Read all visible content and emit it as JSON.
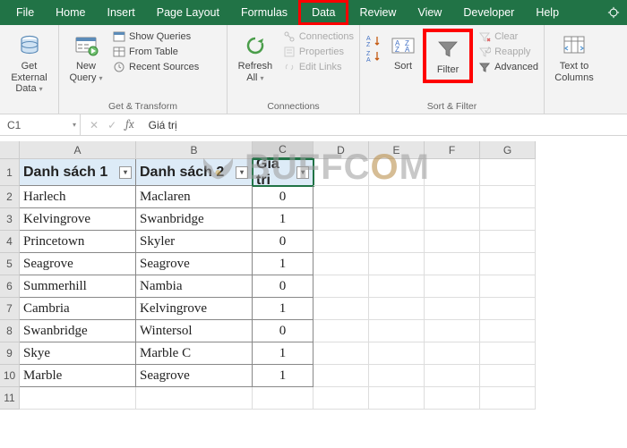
{
  "tabs": {
    "file": "File",
    "home": "Home",
    "insert": "Insert",
    "pageLayout": "Page Layout",
    "formulas": "Formulas",
    "data": "Data",
    "review": "Review",
    "view": "View",
    "developer": "Developer",
    "help": "Help"
  },
  "ribbon": {
    "getExternal": {
      "label": "Get External\nData"
    },
    "newQuery": {
      "label": "New\nQuery"
    },
    "getTransform": {
      "label": "Get & Transform",
      "showQueries": "Show Queries",
      "fromTable": "From Table",
      "recentSources": "Recent Sources"
    },
    "refreshAll": {
      "label": "Refresh\nAll"
    },
    "connections": {
      "label": "Connections",
      "connections": "Connections",
      "properties": "Properties",
      "editLinks": "Edit Links"
    },
    "sort": {
      "label": "Sort"
    },
    "filter": {
      "label": "Filter"
    },
    "sortFilter": {
      "label": "Sort & Filter",
      "clear": "Clear",
      "reapply": "Reapply",
      "advanced": "Advanced"
    },
    "textToColumns": {
      "label": "Text to\nColumns"
    }
  },
  "namebox": {
    "value": "C1"
  },
  "formula": {
    "value": "Giá trị"
  },
  "columns": {
    "A": "A",
    "B": "B",
    "C": "C",
    "D": "D",
    "E": "E",
    "F": "F",
    "G": "G"
  },
  "table": {
    "headers": {
      "a": "Danh sách 1",
      "b": "Danh sách 2",
      "c": "Giá trị"
    },
    "rows": [
      {
        "n": "2",
        "a": "Harlech",
        "b": "Maclaren",
        "c": "0"
      },
      {
        "n": "3",
        "a": "Kelvingrove",
        "b": "Swanbridge",
        "c": "1"
      },
      {
        "n": "4",
        "a": "Princetown",
        "b": "Skyler",
        "c": "0"
      },
      {
        "n": "5",
        "a": "Seagrove",
        "b": "Seagrove",
        "c": "1"
      },
      {
        "n": "6",
        "a": "Summerhill",
        "b": "Nambia",
        "c": "0"
      },
      {
        "n": "7",
        "a": "Cambria",
        "b": "Kelvingrove",
        "c": "1"
      },
      {
        "n": "8",
        "a": "Swanbridge",
        "b": "Wintersol",
        "c": "0"
      },
      {
        "n": "9",
        "a": "Skye",
        "b": "Marble C",
        "c": "1"
      },
      {
        "n": "10",
        "a": "Marble",
        "b": "Seagrove",
        "c": "1"
      }
    ],
    "extraRow": "11"
  },
  "watermark": {
    "text1": "B",
    "text2": "UFFC",
    "o": "O",
    "text3": "M"
  }
}
